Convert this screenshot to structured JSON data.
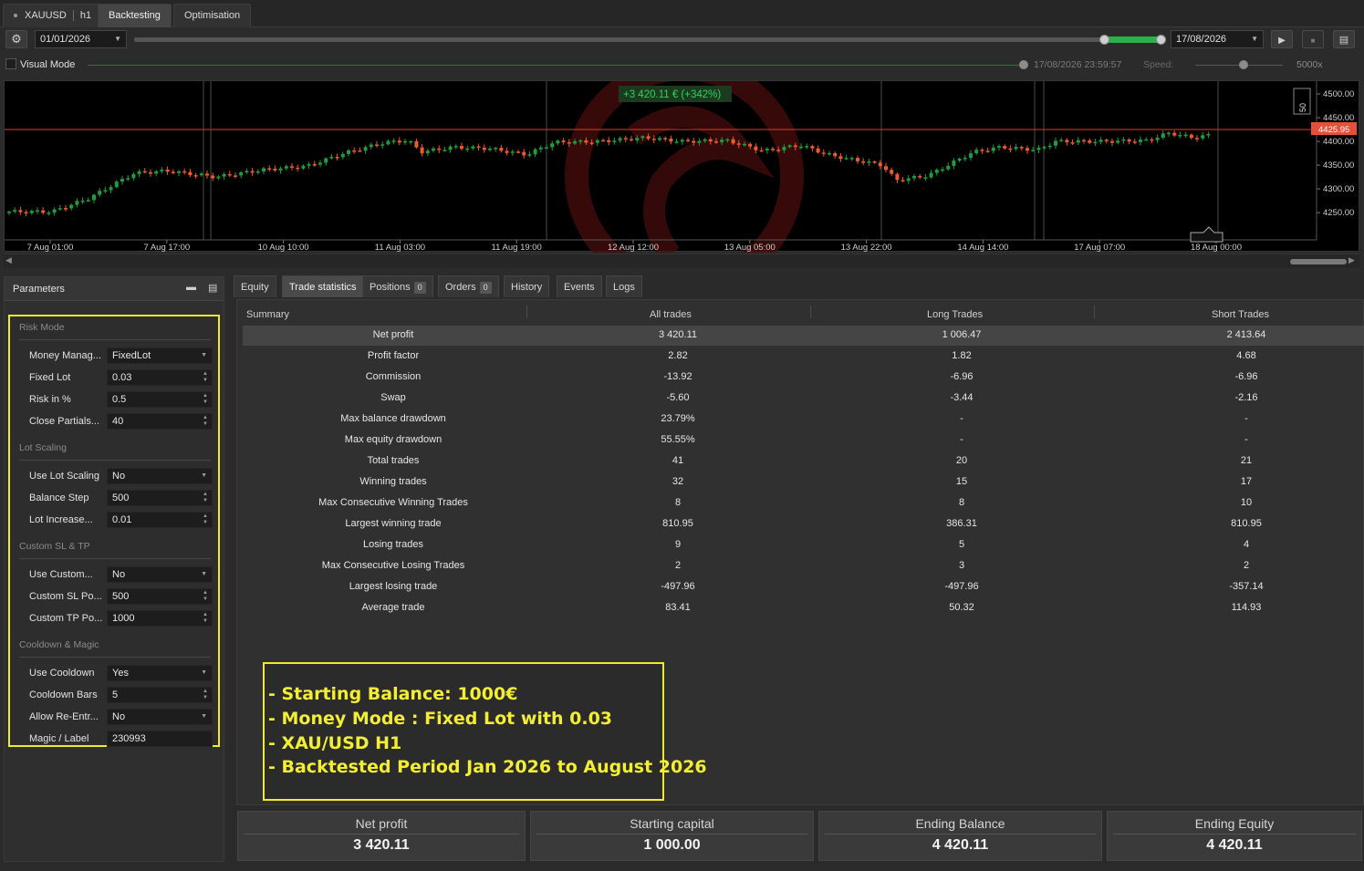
{
  "top_tabs": {
    "symbol": "XAUUSD",
    "timeframe": "h1",
    "backtesting": "Backtesting",
    "optimisation": "Optimisation"
  },
  "toolbar": {
    "start_date": "01/01/2026",
    "end_date": "17/08/2026",
    "visual_mode": "Visual Mode",
    "visual_time": "17/08/2026 23:59:57",
    "speed_label": "Speed:",
    "speed_value": "5000x"
  },
  "chart": {
    "pnl_badge": "+3 420.11 € (+342%)",
    "price_label": "4425.95",
    "y_ticks": [
      "4500.00",
      "4450.00",
      "4400.00",
      "4350.00",
      "4300.00",
      "4250.00"
    ],
    "x_ticks": [
      "7 Aug 01:00",
      "7 Aug 17:00",
      "10 Aug 10:00",
      "11 Aug 03:00",
      "11 Aug 19:00",
      "12 Aug 12:00",
      "13 Aug 05:00",
      "13 Aug 22:00",
      "14 Aug 14:00",
      "17 Aug 07:00",
      "18 Aug 00:00"
    ],
    "zoom_label": "50",
    "colors": {
      "up": "#1f9e3d",
      "down": "#f0592a",
      "price_line": "#e23a2a"
    }
  },
  "parameters": {
    "title": "Parameters",
    "groups": [
      {
        "title": "Risk Mode",
        "items": [
          {
            "label": "Money Manag...",
            "value": "FixedLot",
            "kind": "dropdown"
          },
          {
            "label": "Fixed Lot",
            "value": "0.03",
            "kind": "spin"
          },
          {
            "label": "Risk in %",
            "value": "0.5",
            "kind": "spin"
          },
          {
            "label": "Close Partials...",
            "value": "40",
            "kind": "spin"
          }
        ]
      },
      {
        "title": "Lot Scaling",
        "items": [
          {
            "label": "Use Lot Scaling",
            "value": "No",
            "kind": "dropdown"
          },
          {
            "label": "Balance Step",
            "value": "500",
            "kind": "spin"
          },
          {
            "label": "Lot Increase...",
            "value": "0.01",
            "kind": "spin"
          }
        ]
      },
      {
        "title": "Custom SL & TP",
        "items": [
          {
            "label": "Use Custom...",
            "value": "No",
            "kind": "dropdown"
          },
          {
            "label": "Custom SL Po...",
            "value": "500",
            "kind": "spin"
          },
          {
            "label": "Custom TP Po...",
            "value": "1000",
            "kind": "spin"
          }
        ]
      },
      {
        "title": "Cooldown & Magic",
        "items": [
          {
            "label": "Use Cooldown",
            "value": "Yes",
            "kind": "dropdown"
          },
          {
            "label": "Cooldown Bars",
            "value": "5",
            "kind": "spin"
          },
          {
            "label": "Allow Re-Entr...",
            "value": "No",
            "kind": "dropdown"
          },
          {
            "label": "Magic / Label",
            "value": "230993",
            "kind": "text"
          }
        ]
      }
    ]
  },
  "result_tabs": [
    {
      "label": "Equity"
    },
    {
      "label": "Trade statistics"
    },
    {
      "label": "Positions",
      "badge": "0"
    },
    {
      "label": "Orders",
      "badge": "0"
    },
    {
      "label": "History"
    },
    {
      "label": "Events"
    },
    {
      "label": "Logs"
    }
  ],
  "stats": {
    "headers": [
      "Summary",
      "All trades",
      "Long Trades",
      "Short Trades"
    ],
    "rows": [
      [
        "Net profit",
        "3 420.11",
        "1 006.47",
        "2 413.64"
      ],
      [
        "Profit factor",
        "2.82",
        "1.82",
        "4.68"
      ],
      [
        "Commission",
        "-13.92",
        "-6.96",
        "-6.96"
      ],
      [
        "Swap",
        "-5.60",
        "-3.44",
        "-2.16"
      ],
      [
        "Max balance drawdown",
        "23.79%",
        "-",
        "-"
      ],
      [
        "Max equity drawdown",
        "55.55%",
        "-",
        "-"
      ],
      [
        "Total trades",
        "41",
        "20",
        "21"
      ],
      [
        "Winning trades",
        "32",
        "15",
        "17"
      ],
      [
        "Max Consecutive Winning Trades",
        "8",
        "8",
        "10"
      ],
      [
        "Largest winning trade",
        "810.95",
        "386.31",
        "810.95"
      ],
      [
        "Losing trades",
        "9",
        "5",
        "4"
      ],
      [
        "Max Consecutive Losing Trades",
        "2",
        "3",
        "2"
      ],
      [
        "Largest losing trade",
        "-497.96",
        "-497.96",
        "-357.14"
      ],
      [
        "Average trade",
        "83.41",
        "50.32",
        "114.93"
      ]
    ]
  },
  "note": {
    "lines": [
      "- Starting Balance:  1000€",
      "- Money Mode : Fixed Lot with 0.03",
      "- XAU/USD H1",
      "- Backtested Period Jan 2026 to August 2026"
    ]
  },
  "summary_cards": [
    {
      "label": "Net profit",
      "value": "3 420.11"
    },
    {
      "label": "Starting capital",
      "value": "1 000.00"
    },
    {
      "label": "Ending Balance",
      "value": "4 420.11"
    },
    {
      "label": "Ending Equity",
      "value": "4 420.11"
    }
  ]
}
